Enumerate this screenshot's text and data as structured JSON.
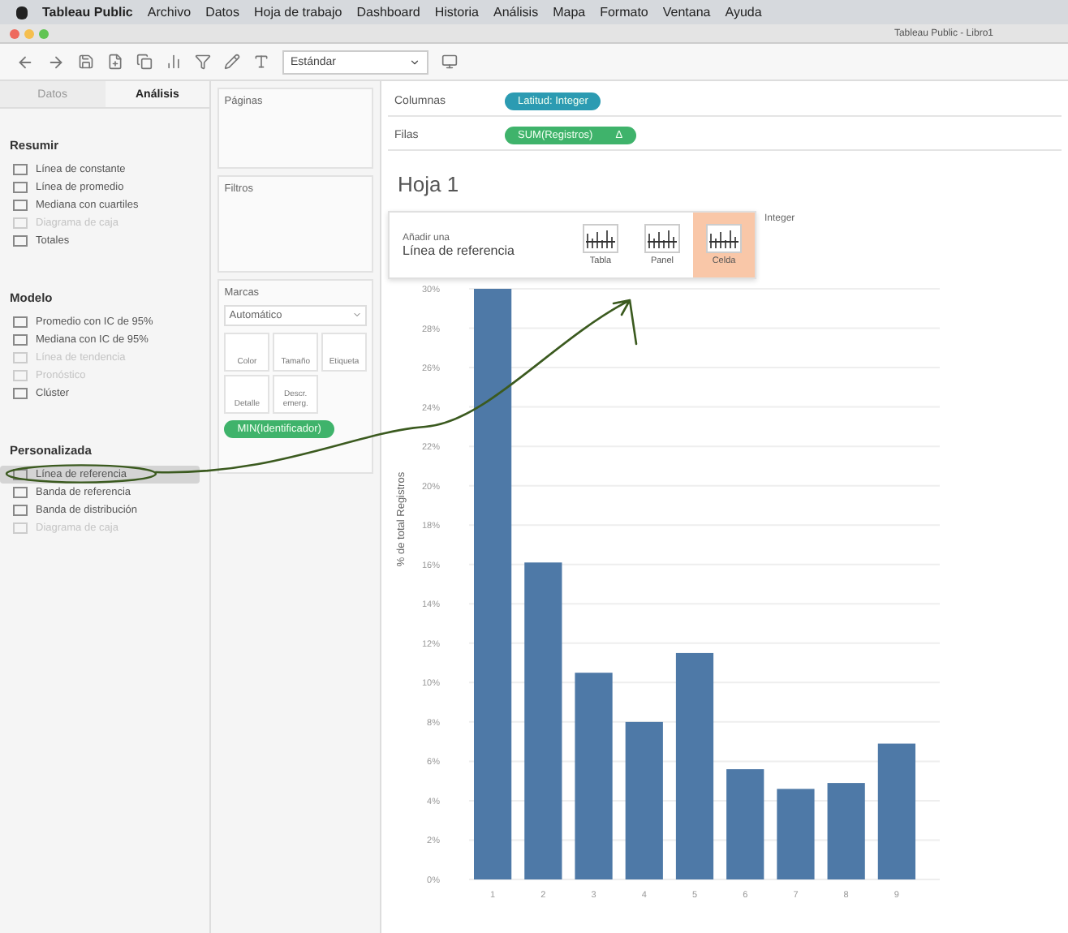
{
  "menu_bar": {
    "app": "Tableau Public",
    "items": [
      "Archivo",
      "Datos",
      "Hoja de trabajo",
      "Dashboard",
      "Historia",
      "Análisis",
      "Mapa",
      "Formato",
      "Ventana",
      "Ayuda"
    ]
  },
  "window": {
    "title": "Tableau Public - Libro1"
  },
  "toolbar": {
    "fit_dropdown": "Estándar"
  },
  "side_tabs": [
    {
      "label": "Datos",
      "selected": false
    },
    {
      "label": "Análisis",
      "selected": true
    }
  ],
  "analytics_sections": [
    {
      "title": "Resumir",
      "items": [
        {
          "label": "Línea de constante",
          "disabled": false,
          "selected": false
        },
        {
          "label": "Línea de promedio",
          "disabled": false,
          "selected": false
        },
        {
          "label": "Mediana con cuartiles",
          "disabled": false,
          "selected": false
        },
        {
          "label": "Diagrama de caja",
          "disabled": true,
          "selected": false
        },
        {
          "label": "Totales",
          "disabled": false,
          "selected": false
        }
      ]
    },
    {
      "title": "Modelo",
      "items": [
        {
          "label": "Promedio con IC de 95%",
          "disabled": false,
          "selected": false
        },
        {
          "label": "Mediana con IC de 95%",
          "disabled": false,
          "selected": false
        },
        {
          "label": "Línea de tendencia",
          "disabled": true,
          "selected": false
        },
        {
          "label": "Pronóstico",
          "disabled": true,
          "selected": false
        },
        {
          "label": "Clúster",
          "disabled": false,
          "selected": false
        }
      ]
    },
    {
      "title": "Personalizada",
      "items": [
        {
          "label": "Línea de referencia",
          "disabled": false,
          "selected": true
        },
        {
          "label": "Banda de referencia",
          "disabled": false,
          "selected": false
        },
        {
          "label": "Banda de distribución",
          "disabled": false,
          "selected": false
        },
        {
          "label": "Diagrama de caja",
          "disabled": true,
          "selected": false
        }
      ]
    }
  ],
  "shelves": {
    "pages": "Páginas",
    "filters": "Filtros",
    "marks": "Marcas",
    "mark_type": "Automático",
    "mark_buttons": [
      "Color",
      "Tamaño",
      "Etiqueta",
      "Detalle",
      "Descr. emerg."
    ],
    "mark_pill": "MIN(Identificador)"
  },
  "columns_shelf": {
    "label": "Columnas",
    "pill": "Latitud: Integer"
  },
  "rows_shelf": {
    "label": "Filas",
    "pill": "SUM(Registros)",
    "delta": "Δ"
  },
  "sheet": {
    "title": "Hoja 1",
    "header_fragment": "Integer",
    "drop_menu": {
      "caption": "Añadir una",
      "title": "Línea de referencia",
      "options": [
        {
          "label": "Tabla",
          "selected": false
        },
        {
          "label": "Panel",
          "selected": false
        },
        {
          "label": "Celda",
          "selected": true
        }
      ]
    },
    "chart_data": {
      "type": "bar",
      "grid": true,
      "ylabel": "% de total Registros",
      "categories": [
        "1",
        "2",
        "3",
        "4",
        "5",
        "6",
        "7",
        "8",
        "9"
      ],
      "values": [
        30,
        16.1,
        10.5,
        8.0,
        11.5,
        5.6,
        4.6,
        4.9,
        6.9
      ],
      "ylim": [
        0,
        30
      ],
      "yticks": [
        {
          "value": 0,
          "label": "0%"
        },
        {
          "value": 2,
          "label": "2%"
        },
        {
          "value": 4,
          "label": "4%"
        },
        {
          "value": 6,
          "label": "6%"
        },
        {
          "value": 8,
          "label": "8%"
        },
        {
          "value": 10,
          "label": "10%"
        },
        {
          "value": 12,
          "label": "12%"
        },
        {
          "value": 14,
          "label": "14%"
        },
        {
          "value": 16,
          "label": "16%"
        },
        {
          "value": 18,
          "label": "18%"
        },
        {
          "value": 20,
          "label": "20%"
        },
        {
          "value": 22,
          "label": "22%"
        },
        {
          "value": 24,
          "label": "24%"
        },
        {
          "value": 26,
          "label": "26%"
        },
        {
          "value": 28,
          "label": "28%"
        },
        {
          "value": 30,
          "label": "30%"
        }
      ]
    }
  }
}
